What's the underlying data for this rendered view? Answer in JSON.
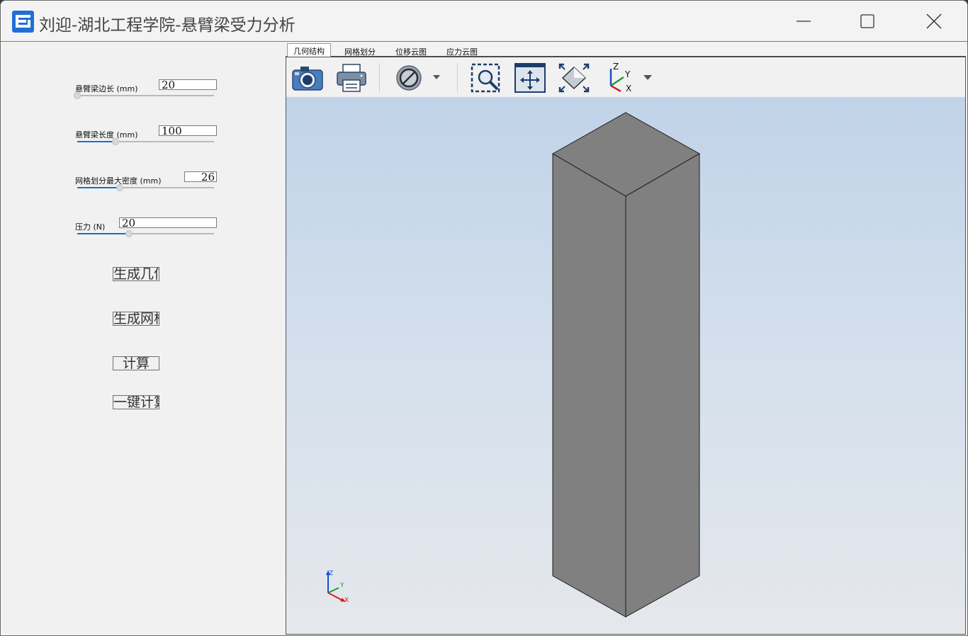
{
  "window": {
    "title": "刘迎-湖北工程学院-悬臂梁受力分析"
  },
  "params": [
    {
      "label": "悬臂梁边长 (mm)",
      "value": "20",
      "slider_fraction": 0.0
    },
    {
      "label": "悬臂梁长度 (mm)",
      "value": "100",
      "slider_fraction": 0.28
    },
    {
      "label": "网格划分最大密度 (mm)",
      "value": "26",
      "slider_fraction": 0.31
    },
    {
      "label": "压力 (N)",
      "value": "20",
      "slider_fraction": 0.38
    }
  ],
  "buttons": [
    {
      "label": "生成几何"
    },
    {
      "label": "生成网格"
    },
    {
      "label": "计算"
    },
    {
      "label": "一键计算"
    }
  ],
  "tabs": [
    {
      "label": "几何结构",
      "active": true
    },
    {
      "label": "网格划分",
      "active": false
    },
    {
      "label": "位移云图",
      "active": false
    },
    {
      "label": "应力云图",
      "active": false
    }
  ],
  "toolbar": {
    "icons": [
      "camera-icon",
      "printer-icon",
      "hide-icon",
      "zoom-box-icon",
      "fit-all-icon",
      "pan-icon",
      "axes-icon"
    ]
  },
  "axes_triad": {
    "x": "X",
    "y": "Y",
    "z": "Z"
  },
  "colors": {
    "accent": "#1a6fc7",
    "beam_face": "#808080",
    "viewer_top": "#bed1e8",
    "viewer_bottom": "#e5e8ec"
  }
}
